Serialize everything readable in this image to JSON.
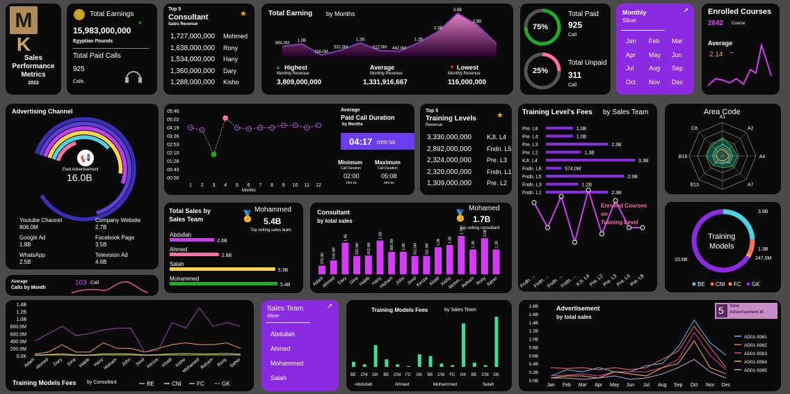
{
  "header": {
    "title_lines": [
      "Sales",
      "Performance",
      "Metrics"
    ],
    "year": "2022"
  },
  "earnings": {
    "label": "Total Earnings",
    "value": "15,983,000,000",
    "unit": "Egyptian Pounds",
    "calls_label": "Total Paid Calls",
    "calls_value": "925",
    "calls_unit": "Calls"
  },
  "top5_consultants": {
    "label_small": "Top 5",
    "title": "Consultant",
    "sub": "Sales Revenue",
    "rows": [
      {
        "value": "1,727,000,000",
        "name": "Mohmed"
      },
      {
        "value": "1,638,000,000",
        "name": "Rony"
      },
      {
        "value": "1,534,000,000",
        "name": "Hany"
      },
      {
        "value": "1,360,000,000",
        "name": "Dary"
      },
      {
        "value": "1,288,000,000",
        "name": "Kisho"
      }
    ]
  },
  "earning_months": {
    "title": "Total Earning",
    "title_suffix": "by Months",
    "highest_label": "Highest",
    "highest_sub": "Monthly Revenue",
    "highest_value": "3,809,000,000",
    "average_label": "Average",
    "average_sub": "Monthly Revenue",
    "average_value": "1,331,916,667",
    "lowest_label": "Lowest",
    "lowest_sub": "Monthly Revenue",
    "lowest_value": "116,000,000"
  },
  "calls_status": {
    "paid_pct": "75%",
    "paid_label": "Total Paid",
    "paid_value": "925",
    "paid_unit": "Call",
    "paid_fraction": 0.75,
    "unpaid_pct": "25%",
    "unpaid_label": "Total Unpaid",
    "unpaid_value": "311",
    "unpaid_unit": "Call",
    "unpaid_fraction": 0.25
  },
  "monthly_slicer": {
    "title": "Monthly",
    "sub": "Slicer",
    "months": [
      "Jan",
      "Feb",
      "Mar",
      "Apr",
      "May",
      "Jun",
      "Jul",
      "Aug",
      "Sep",
      "Oct",
      "Nov",
      "Dec"
    ]
  },
  "enrolled": {
    "title": "Enrolled Courses",
    "count": "2642",
    "count_unit": "Course",
    "avg_label": "Average",
    "avg_value": "2.14",
    "avg_symbol": "~"
  },
  "advertising": {
    "title": "Advertising Channel",
    "center_label": "Paid Advertisement",
    "center_value": "16.0B",
    "channels": [
      {
        "name": "Youtube Channel",
        "value": "806.0M"
      },
      {
        "name": "Company Website",
        "value": "2.7B"
      },
      {
        "name": "Google Ad",
        "value": "1.8B"
      },
      {
        "name": "Facebook Page",
        "value": "3.5B"
      },
      {
        "name": "WhatsApp",
        "value": "2.5B"
      },
      {
        "name": "Television Ad",
        "value": "4.6B"
      }
    ]
  },
  "calls_by_month": {
    "label": "Average",
    "label2": "Calls by Month",
    "value": "103",
    "unit": "Call"
  },
  "call_duration": {
    "title_small": "Average",
    "title": "Paid Call Duration",
    "title_sub": "by Months",
    "avg_value": "04:17",
    "avg_unit": "mm:ss",
    "min_label": "Minimum",
    "min_sub": "Call Duration",
    "min_value": "02:00",
    "min_unit": "mm:ss",
    "max_label": "Maximum",
    "max_sub": "Call Duration",
    "max_value": "05:08",
    "max_unit": "mm:ss",
    "xlabel": "Months"
  },
  "top5_training": {
    "label_small": "Top 5",
    "title": "Training Levels",
    "sub": "Revenue",
    "rows": [
      {
        "value": "3,330,000,000",
        "name": "KJI. L4"
      },
      {
        "value": "2,892,000,000",
        "name": "Fndn. L5"
      },
      {
        "value": "2,324,000,000",
        "name": "Pre. L3"
      },
      {
        "value": "2,320,000,000",
        "name": "Fndn. L1"
      },
      {
        "value": "1,309,000,000",
        "name": "Pre. L2"
      }
    ]
  },
  "level_fees": {
    "title": "Training Level's Fees",
    "title_suffix": "by Sales Team",
    "enrolled_title": [
      "Enrolled Courses",
      "on",
      "Training Level"
    ]
  },
  "area_code": {
    "title": "Area Code"
  },
  "total_sales_team": {
    "title": "Total Sales by",
    "title2": "Sales Team",
    "top_name": "Mohammed",
    "top_value": "5.4B",
    "top_caption": "Top selling sales team"
  },
  "consultant_sales": {
    "title": "Consultant",
    "sub": "by total sales",
    "top_name": "Mohamed",
    "top_value": "1.7B",
    "top_caption": "Top selling consultant"
  },
  "training_models": {
    "title": "Training",
    "title2": "Models"
  },
  "models_by_consultant": {
    "title": "Training Models Fees",
    "title_suffix": "by Consultant"
  },
  "sales_slicer": {
    "title": "Sales Team",
    "sub": "Slicer",
    "items": [
      "Abdullah",
      "Ahmed",
      "Mohammed",
      "Salah"
    ]
  },
  "models_fees_team": {
    "title": "Training Models Fees",
    "title_suffix": "by Sales Team"
  },
  "advertisement": {
    "title": "Advertisement",
    "sub": "by total sales",
    "badge_num": "5",
    "badge_label": "Total",
    "badge_label2": "Advertisement Id"
  },
  "colors": {
    "purple": "#8a2be2",
    "pink": "#e040a0",
    "magenta": "#d63af9",
    "green": "#22aa22",
    "yellow": "#ffd54f",
    "cyan": "#4dd0e1",
    "teal": "#3ddc97",
    "orange": "#f4a24b"
  },
  "chart_data": [
    {
      "id": "earning_by_months",
      "type": "area",
      "x": [
        "Jan",
        "Feb",
        "Mar",
        "Apr",
        "May",
        "Jun",
        "Jul",
        "Aug",
        "Sep",
        "Oct",
        "Nov",
        "Dec"
      ],
      "values": [
        884,
        1100,
        116,
        531,
        1200,
        512,
        442,
        1200,
        2200,
        3800,
        2800,
        1100
      ],
      "data_labels": [
        "884.0M",
        "1.0B",
        "116.0M",
        "531.0M",
        "1.2B",
        "512.0M",
        "442.0M",
        "1.2B",
        "2.2B",
        "3.8B",
        "2.8B",
        ""
      ]
    },
    {
      "id": "avg_call_duration",
      "type": "line",
      "x": [
        "1",
        "2",
        "3",
        "4",
        "5",
        "6",
        "7",
        "8",
        "9",
        "10",
        "11",
        "12"
      ],
      "y_ticks": [
        "05:46",
        "05:02",
        "04:19",
        "03:36",
        "02:53",
        "02:10",
        "01:26",
        "00:43",
        "00:00"
      ],
      "values_minutes": [
        4.3,
        4.1,
        2.0,
        5.13,
        4.3,
        4.2,
        4.3,
        4.3,
        4.5,
        4.5,
        4.3,
        4.5
      ]
    },
    {
      "id": "training_level_fees",
      "type": "bar",
      "orientation": "horizontal",
      "categories": [
        "Pre. L8",
        "Pre. L4",
        "Pre. L3",
        "Pre. L2",
        "KJI. L4",
        "Fndn. L6",
        "Fndn. L5",
        "Fndn. L3",
        "Fndn. L1"
      ],
      "values": [
        1.0,
        1.0,
        2.3,
        1.3,
        3.3,
        0.574,
        2.9,
        1.2,
        2.3
      ],
      "data_labels": [
        "1.0B",
        "1.0B",
        "2.3B",
        "1.3B",
        "3.3B",
        "574.0M",
        "2.9B",
        "1.2B",
        "2.3B"
      ]
    },
    {
      "id": "enrolled_by_level",
      "type": "line",
      "categories": [
        "Fndn. ...",
        "Fndn. ...",
        "Fndn. ...",
        "Fndn. ...",
        "KJI. L4",
        "Pre. L2",
        "Pre. L3",
        "Pre. L4",
        "Pre. L8"
      ],
      "values": [
        300,
        180,
        330,
        110,
        360,
        150,
        310,
        180,
        180
      ]
    },
    {
      "id": "area_code",
      "type": "radar",
      "categories": [
        "A1",
        "A2",
        "A4",
        "A7",
        "B12",
        "B13",
        "B18",
        "C6"
      ],
      "series": [
        {
          "name": "BE",
          "values": [
            0.35,
            0.3,
            0.3,
            0.3,
            0.2,
            0.3,
            0.3,
            0.3
          ]
        },
        {
          "name": "CNI",
          "values": [
            0.2,
            0.2,
            0.2,
            0.25,
            0.15,
            0.2,
            0.2,
            0.2
          ]
        },
        {
          "name": "FC",
          "values": [
            0.2,
            0.15,
            0.2,
            0.15,
            0.15,
            0.15,
            0.2,
            0.2
          ]
        },
        {
          "name": "GK",
          "values": [
            0.55,
            0.4,
            0.45,
            0.45,
            0.35,
            0.4,
            0.5,
            0.45
          ]
        }
      ]
    },
    {
      "id": "total_sales_team",
      "type": "bar",
      "orientation": "horizontal",
      "categories": [
        "Abdullah",
        "Ahmed",
        "Salah",
        "Mohammed"
      ],
      "values": [
        2.6,
        2.8,
        5.3,
        5.4
      ],
      "data_labels": [
        "2.6B",
        "2.8B",
        "5.3B",
        "5.4B"
      ]
    },
    {
      "id": "consultant_sales",
      "type": "bar",
      "categories": [
        "Adam",
        "Ahmed",
        "Dary",
        "Dina",
        "Habib",
        "Hany",
        "Hisham",
        "John",
        "Jood",
        "Kenza",
        "Khalil",
        "Kisho",
        "Mohm...",
        "Reham",
        "Rony",
        "Saher"
      ],
      "values": [
        0.379,
        0.616,
        1.4,
        0.815,
        0.832,
        1.5,
        0.995,
        1.0,
        0.812,
        0.811,
        1.2,
        1.3,
        1.7,
        1.1,
        1.6,
        1.1
      ],
      "data_labels": [
        "379.0M",
        "616.0M",
        "1.4B",
        "815.0M",
        "832.0M",
        "1.5B",
        "995.0M",
        "1.0B",
        "812.0M",
        "811.0M",
        "1.2B",
        "1.3B",
        "1.7B",
        "1.1B",
        "1.6B",
        "1.1B"
      ]
    },
    {
      "id": "training_models",
      "type": "pie",
      "series": [
        {
          "name": "BE",
          "value": 3.9,
          "label": "3.9B"
        },
        {
          "name": "CNI",
          "value": 1.3,
          "label": "1.3B"
        },
        {
          "name": "FC",
          "value": 0.247,
          "label": "247.0M"
        },
        {
          "name": "GK",
          "value": 10.6,
          "label": "10.6B"
        }
      ]
    },
    {
      "id": "models_fees_consultant",
      "type": "line",
      "categories": [
        "Adam",
        "Ahmed",
        "Dary",
        "Dina",
        "Habib",
        "Hany",
        "Hisham",
        "John",
        "Jood",
        "Kenza",
        "Khalil",
        "Kisho",
        "Mohamed",
        "Reham",
        "Rony",
        "Saher"
      ],
      "y_ticks": [
        "1.4B",
        "1.2B",
        "1.0B",
        "800.0M",
        "600.0M",
        "400.0M",
        "200.0M",
        "0.0K"
      ],
      "series": [
        {
          "name": "BE",
          "values": [
            0.05,
            0.1,
            0.3,
            0.1,
            0.1,
            0.35,
            0.2,
            0.2,
            0.1,
            0.2,
            0.3,
            0.35,
            0.3,
            0.3,
            0.35,
            0.2
          ]
        },
        {
          "name": "CNI",
          "values": [
            0.02,
            0.03,
            0.05,
            0.02,
            0.02,
            0.05,
            0.05,
            0.05,
            0.02,
            0.03,
            0.05,
            0.06,
            0.05,
            0.05,
            0.06,
            0.04
          ]
        },
        {
          "name": "FC",
          "values": [
            0.01,
            0.02,
            0.02,
            0.01,
            0.01,
            0.02,
            0.02,
            0.02,
            0.01,
            0.02,
            0.02,
            0.02,
            0.02,
            0.02,
            0.02,
            0.02
          ]
        },
        {
          "name": "GK",
          "values": [
            0.4,
            0.6,
            0.8,
            0.55,
            0.6,
            0.7,
            0.75,
            0.75,
            0.1,
            0.15,
            0.9,
            0.75,
            1.3,
            0.8,
            0.9,
            0.8
          ]
        }
      ]
    },
    {
      "id": "models_fees_team",
      "type": "bar",
      "categories": [
        "BE",
        "CNI",
        "GK",
        "BE",
        "CNI",
        "FC",
        "GK",
        "BE",
        "CNI",
        "FC",
        "GK",
        "BE",
        "CNI",
        "GK"
      ],
      "groups": [
        "Abdullah",
        "Ahmed",
        "Mohammed",
        "Salah"
      ],
      "values": [
        0.3,
        0.15,
        1.3,
        0.45,
        0.15,
        0.05,
        0.75,
        0.65,
        0.2,
        0.1,
        2.6,
        0.25,
        0.1,
        3.0
      ]
    },
    {
      "id": "advertisement",
      "type": "line",
      "x": [
        "Jan",
        "Feb",
        "Mar",
        "Apr",
        "May",
        "Jun",
        "Jul",
        "Aug",
        "Sep",
        "Oct",
        "Nov",
        "Dec"
      ],
      "y_ticks": [
        "1.8B",
        "1.6B",
        "1.4B",
        "1.2B",
        "1.0B",
        "0.8B",
        "0.6B",
        "0.4B",
        "0.2B",
        "0.0B"
      ],
      "series": [
        {
          "name": "AD01-9361",
          "values": [
            0.1,
            0.25,
            0.2,
            0.3,
            0.2,
            0.2,
            0.35,
            0.4,
            0.8,
            1.45,
            0.9,
            0.6
          ]
        },
        {
          "name": "AD01-9362",
          "values": [
            0.3,
            0.28,
            0.3,
            0.25,
            0.3,
            0.25,
            0.3,
            0.5,
            0.7,
            1.3,
            0.8,
            0.3
          ]
        },
        {
          "name": "AD01-9363",
          "values": [
            0.1,
            0.12,
            0.15,
            0.1,
            0.2,
            0.2,
            0.2,
            0.3,
            0.5,
            1.15,
            0.6,
            0.25
          ]
        },
        {
          "name": "AD01-9364",
          "values": [
            0.05,
            0.1,
            0.1,
            0.05,
            0.2,
            0.15,
            0.1,
            0.3,
            0.4,
            0.95,
            0.3,
            0.15
          ]
        },
        {
          "name": "AD01-9365",
          "values": [
            0.05,
            0.05,
            0.02,
            0.05,
            0.1,
            0.02,
            0.05,
            0.15,
            0.3,
            0.5,
            0.2,
            0.05
          ]
        }
      ]
    }
  ]
}
